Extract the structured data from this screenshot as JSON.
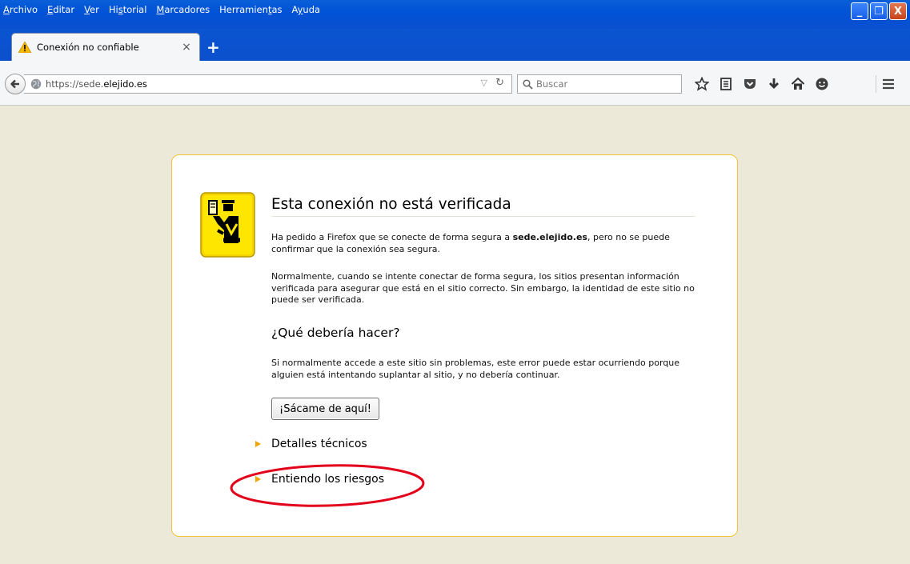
{
  "menubar": {
    "items": [
      {
        "label": "Archivo",
        "accel": "A"
      },
      {
        "label": "Editar",
        "accel": "E"
      },
      {
        "label": "Ver",
        "accel": "V"
      },
      {
        "label": "Historial",
        "accel": "s"
      },
      {
        "label": "Marcadores",
        "accel": "M"
      },
      {
        "label": "Herramientas",
        "accel": "t"
      },
      {
        "label": "Ayuda",
        "accel": "y"
      }
    ]
  },
  "window_buttons": {
    "minimize": "_",
    "maximize": "❐",
    "close": "X"
  },
  "tab": {
    "title": "Conexión no confiable",
    "close": "×",
    "new_tab": "+"
  },
  "navbar": {
    "url_prefix": "https://sede.",
    "url_domain": "elejido.es",
    "search_placeholder": "Buscar"
  },
  "error": {
    "title": "Esta conexión no está verificada",
    "p1_before": "Ha pedido a Firefox que se conecte de forma segura a ",
    "p1_host": "sede.elejido.es",
    "p1_after": ", pero no se puede confirmar que la conexión sea segura.",
    "p2": "Normalmente, cuando se intente conectar de forma segura, los sitios presentan información verificada para asegurar que está en el sitio correcto. Sin embargo, la identidad de este sitio no puede ser verificada.",
    "subtitle": "¿Qué debería hacer?",
    "p3": "Si normalmente accede a este sitio sin problemas, este error puede estar ocurriendo porque alguien está intentando suplantar al sitio, y no debería continuar.",
    "get_out_button": "¡Sácame de aquí!",
    "technical_details": "Detalles técnicos",
    "understand_risks": "Entiendo los riesgos"
  },
  "colors": {
    "titlebar": "#0a5fd8",
    "page_bg": "#ece9d8",
    "box_border": "#f1c43a",
    "expander_arrow": "#f0a500",
    "annotation_circle": "#e3001b"
  }
}
